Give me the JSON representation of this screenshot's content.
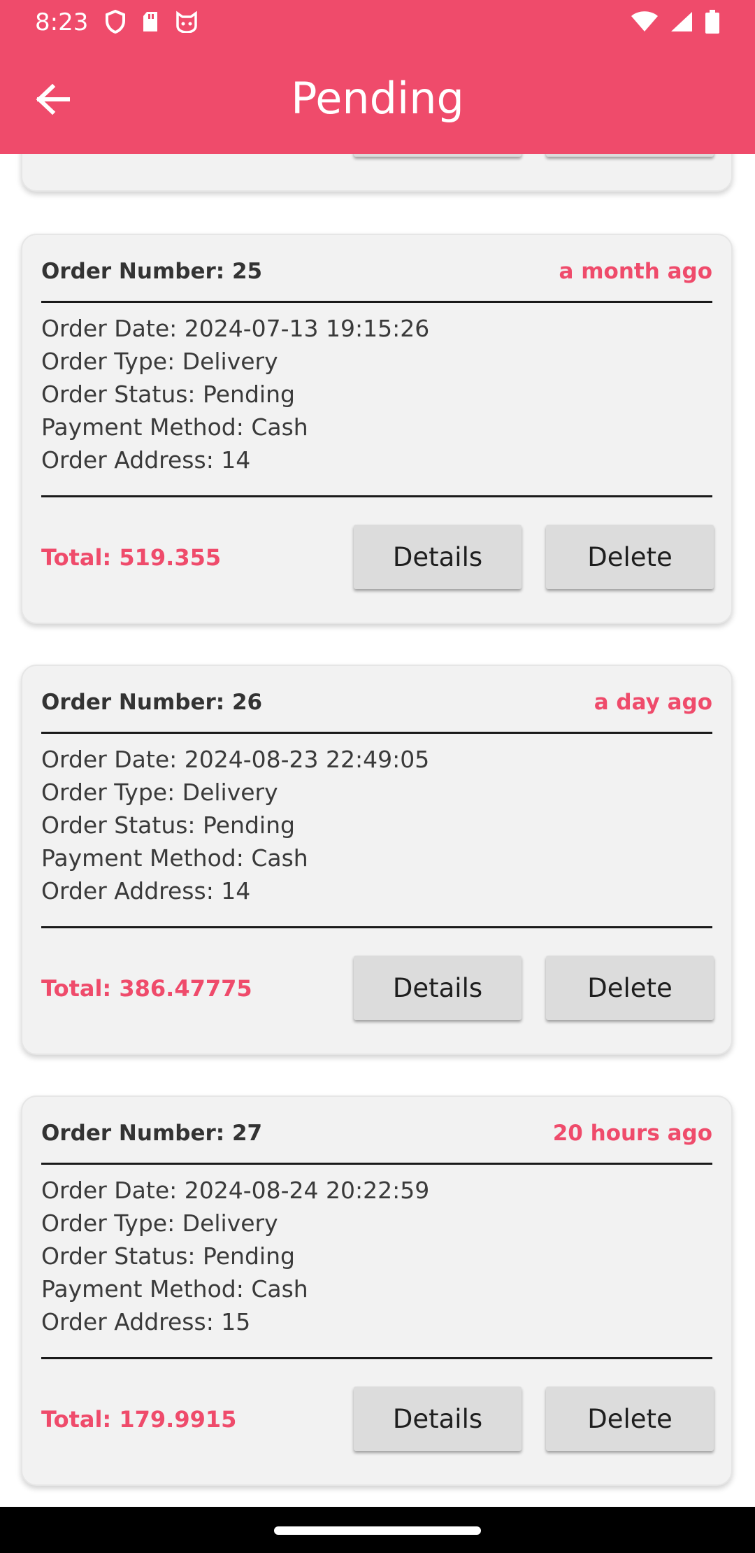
{
  "status_bar": {
    "time": "8:23",
    "left_icons": [
      "shield-icon",
      "sd-card-icon",
      "cat-face-icon"
    ],
    "right_icons": [
      "wifi-icon",
      "signal-icon",
      "battery-icon"
    ]
  },
  "app_bar": {
    "title": "Pending",
    "back_icon": "arrow-left-icon",
    "color": "#ef4b6b"
  },
  "labels": {
    "details_button": "Details",
    "delete_button": "Delete"
  },
  "orders": [
    {
      "order_number": "",
      "time_ago": "",
      "date": "",
      "type": "",
      "status": "",
      "payment": "",
      "address": "",
      "total": ""
    },
    {
      "order_number": "Order Number: 25",
      "time_ago": "a month ago",
      "date": "Order Date: 2024-07-13 19:15:26",
      "type": "Order Type: Delivery",
      "status": "Order Status: Pending",
      "payment": "Payment Method: Cash",
      "address": "Order Address: 14",
      "total": "Total: 519.355"
    },
    {
      "order_number": "Order Number: 26",
      "time_ago": "a day ago",
      "date": "Order Date: 2024-08-23 22:49:05",
      "type": "Order Type: Delivery",
      "status": "Order Status: Pending",
      "payment": "Payment Method: Cash",
      "address": "Order Address: 14",
      "total": "Total: 386.47775"
    },
    {
      "order_number": "Order Number: 27",
      "time_ago": "20 hours ago",
      "date": "Order Date: 2024-08-24 20:22:59",
      "type": "Order Type: Delivery",
      "status": "Order Status: Pending",
      "payment": "Payment Method: Cash",
      "address": "Order Address: 15",
      "total": "Total: 179.9915"
    }
  ],
  "colors": {
    "accent": "#ef4b6b",
    "card_background": "#f2f2f2",
    "button_background": "#dcdcdc"
  }
}
